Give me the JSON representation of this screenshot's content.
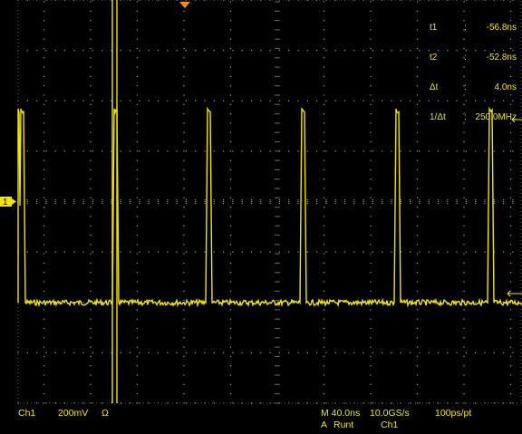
{
  "cursors": [
    {
      "label": "t1",
      "sep": ":",
      "value": "-56.8ns"
    },
    {
      "label": "t2",
      "sep": ":",
      "value": "-52.8ns"
    },
    {
      "label": "Δt",
      "sep": ":",
      "value": "4.0ns"
    },
    {
      "label": "1/Δt",
      "sep": ":",
      "value": "250.0MHz"
    }
  ],
  "channel": {
    "name": "Ch1",
    "scale": "200mV",
    "coupling": "Ω"
  },
  "horizontal": {
    "timebase": "M 40.0ns",
    "sample_rate": "10.0GS/s",
    "resolution": "100ps/pt"
  },
  "trigger": {
    "mode": "A",
    "type": "Runt",
    "source": "Ch1"
  },
  "ground_marker": "1",
  "colors": {
    "trace": "#f2e600",
    "grid": "#8a8a8a",
    "background": "#000000",
    "trigger_marker": "#ff8c1a"
  }
}
